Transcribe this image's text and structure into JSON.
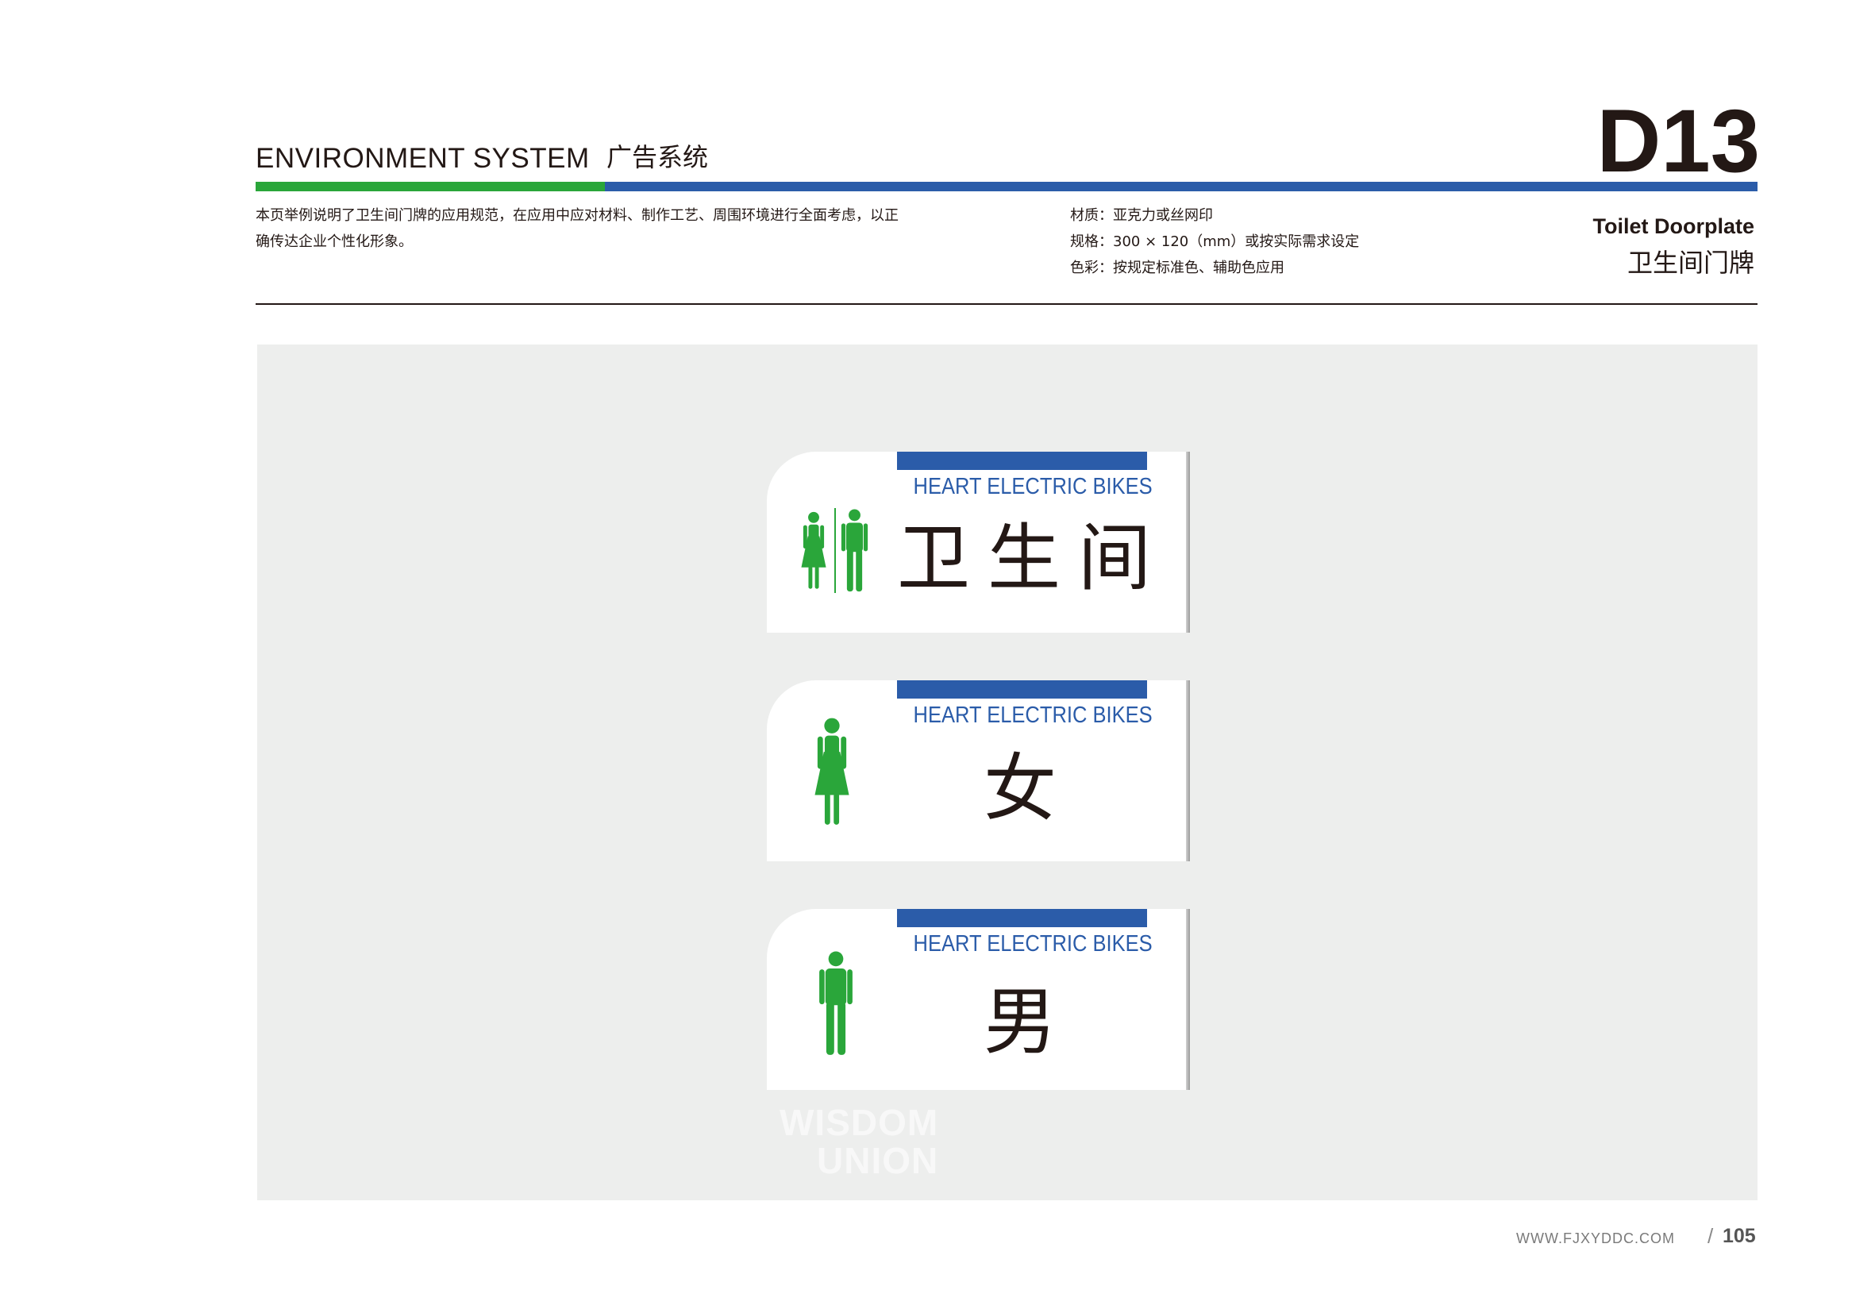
{
  "header": {
    "title_en": "ENVIRONMENT SYSTEM",
    "title_cn": "广告系统",
    "code": "D13",
    "description_lines": [
      "本页举例说明了卫生间门牌的应用规范，在应用中应对材料、制作工艺、周围环境进行全面考虑，以正",
      "确传达企业个性化形象。"
    ],
    "spec_lines": [
      "材质：亚克力或丝网印",
      "规格：300 × 120（mm）或按实际需求设定",
      "色彩：按规定标准色、辅助色应用"
    ],
    "subtitle_en": "Toilet Doorplate",
    "subtitle_cn": "卫生间门牌"
  },
  "colors": {
    "green": "#2aa63a",
    "blue": "#2b5ca9",
    "ink": "#231815",
    "panel": "#edeeed"
  },
  "signs": [
    {
      "brand": "HEART ELECTRIC BIKES",
      "label": "卫生间",
      "icon": "female-male-icon"
    },
    {
      "brand": "HEART ELECTRIC BIKES",
      "label": "女",
      "icon": "female-icon"
    },
    {
      "brand": "HEART ELECTRIC BIKES",
      "label": "男",
      "icon": "male-icon"
    }
  ],
  "watermark": {
    "line1": "WISDOM",
    "line2": "UNION"
  },
  "footer": {
    "website": "WWW.FJXYDDC.COM",
    "page_prefix": "/",
    "page": "105"
  }
}
